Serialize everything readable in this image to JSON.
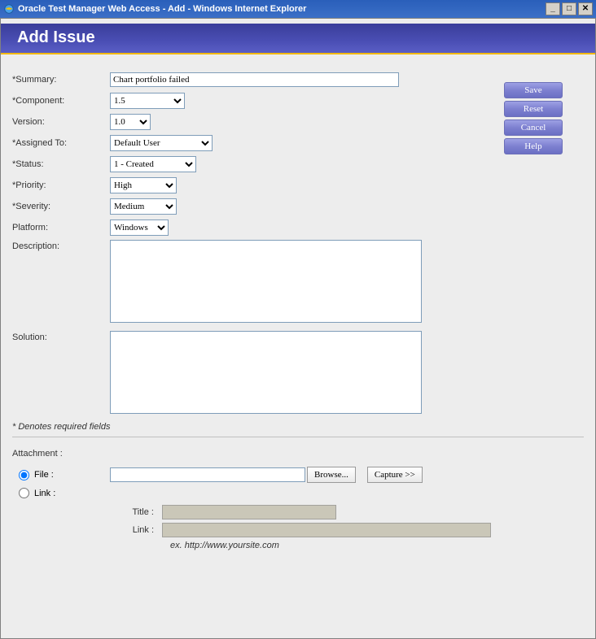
{
  "window": {
    "title": "Oracle Test Manager Web Access - Add - Windows Internet Explorer"
  },
  "banner": {
    "title": "Add Issue"
  },
  "labels": {
    "summary": "*Summary:",
    "component": "*Component:",
    "version": "Version:",
    "assigned_to": "*Assigned To:",
    "status": "*Status:",
    "priority": "*Priority:",
    "severity": "*Severity:",
    "platform": "Platform:",
    "description": "Description:",
    "solution": "Solution:"
  },
  "values": {
    "summary": "Chart portfolio failed",
    "component": "1.5",
    "version": "1.0",
    "assigned_to": "Default User",
    "status": "1 - Created",
    "priority": "High",
    "severity": "Medium",
    "platform": "Windows",
    "description": "",
    "solution": ""
  },
  "buttons": {
    "save": "Save",
    "reset": "Reset",
    "cancel": "Cancel",
    "help": "Help",
    "browse": "Browse...",
    "capture": "Capture >>"
  },
  "required_note": "* Denotes required fields",
  "attachment": {
    "heading": "Attachment :",
    "file_label": "File :",
    "link_label": "Link :",
    "title_label": "Title :",
    "link_field_label": "Link :",
    "example": "ex. http://www.yoursite.com"
  }
}
